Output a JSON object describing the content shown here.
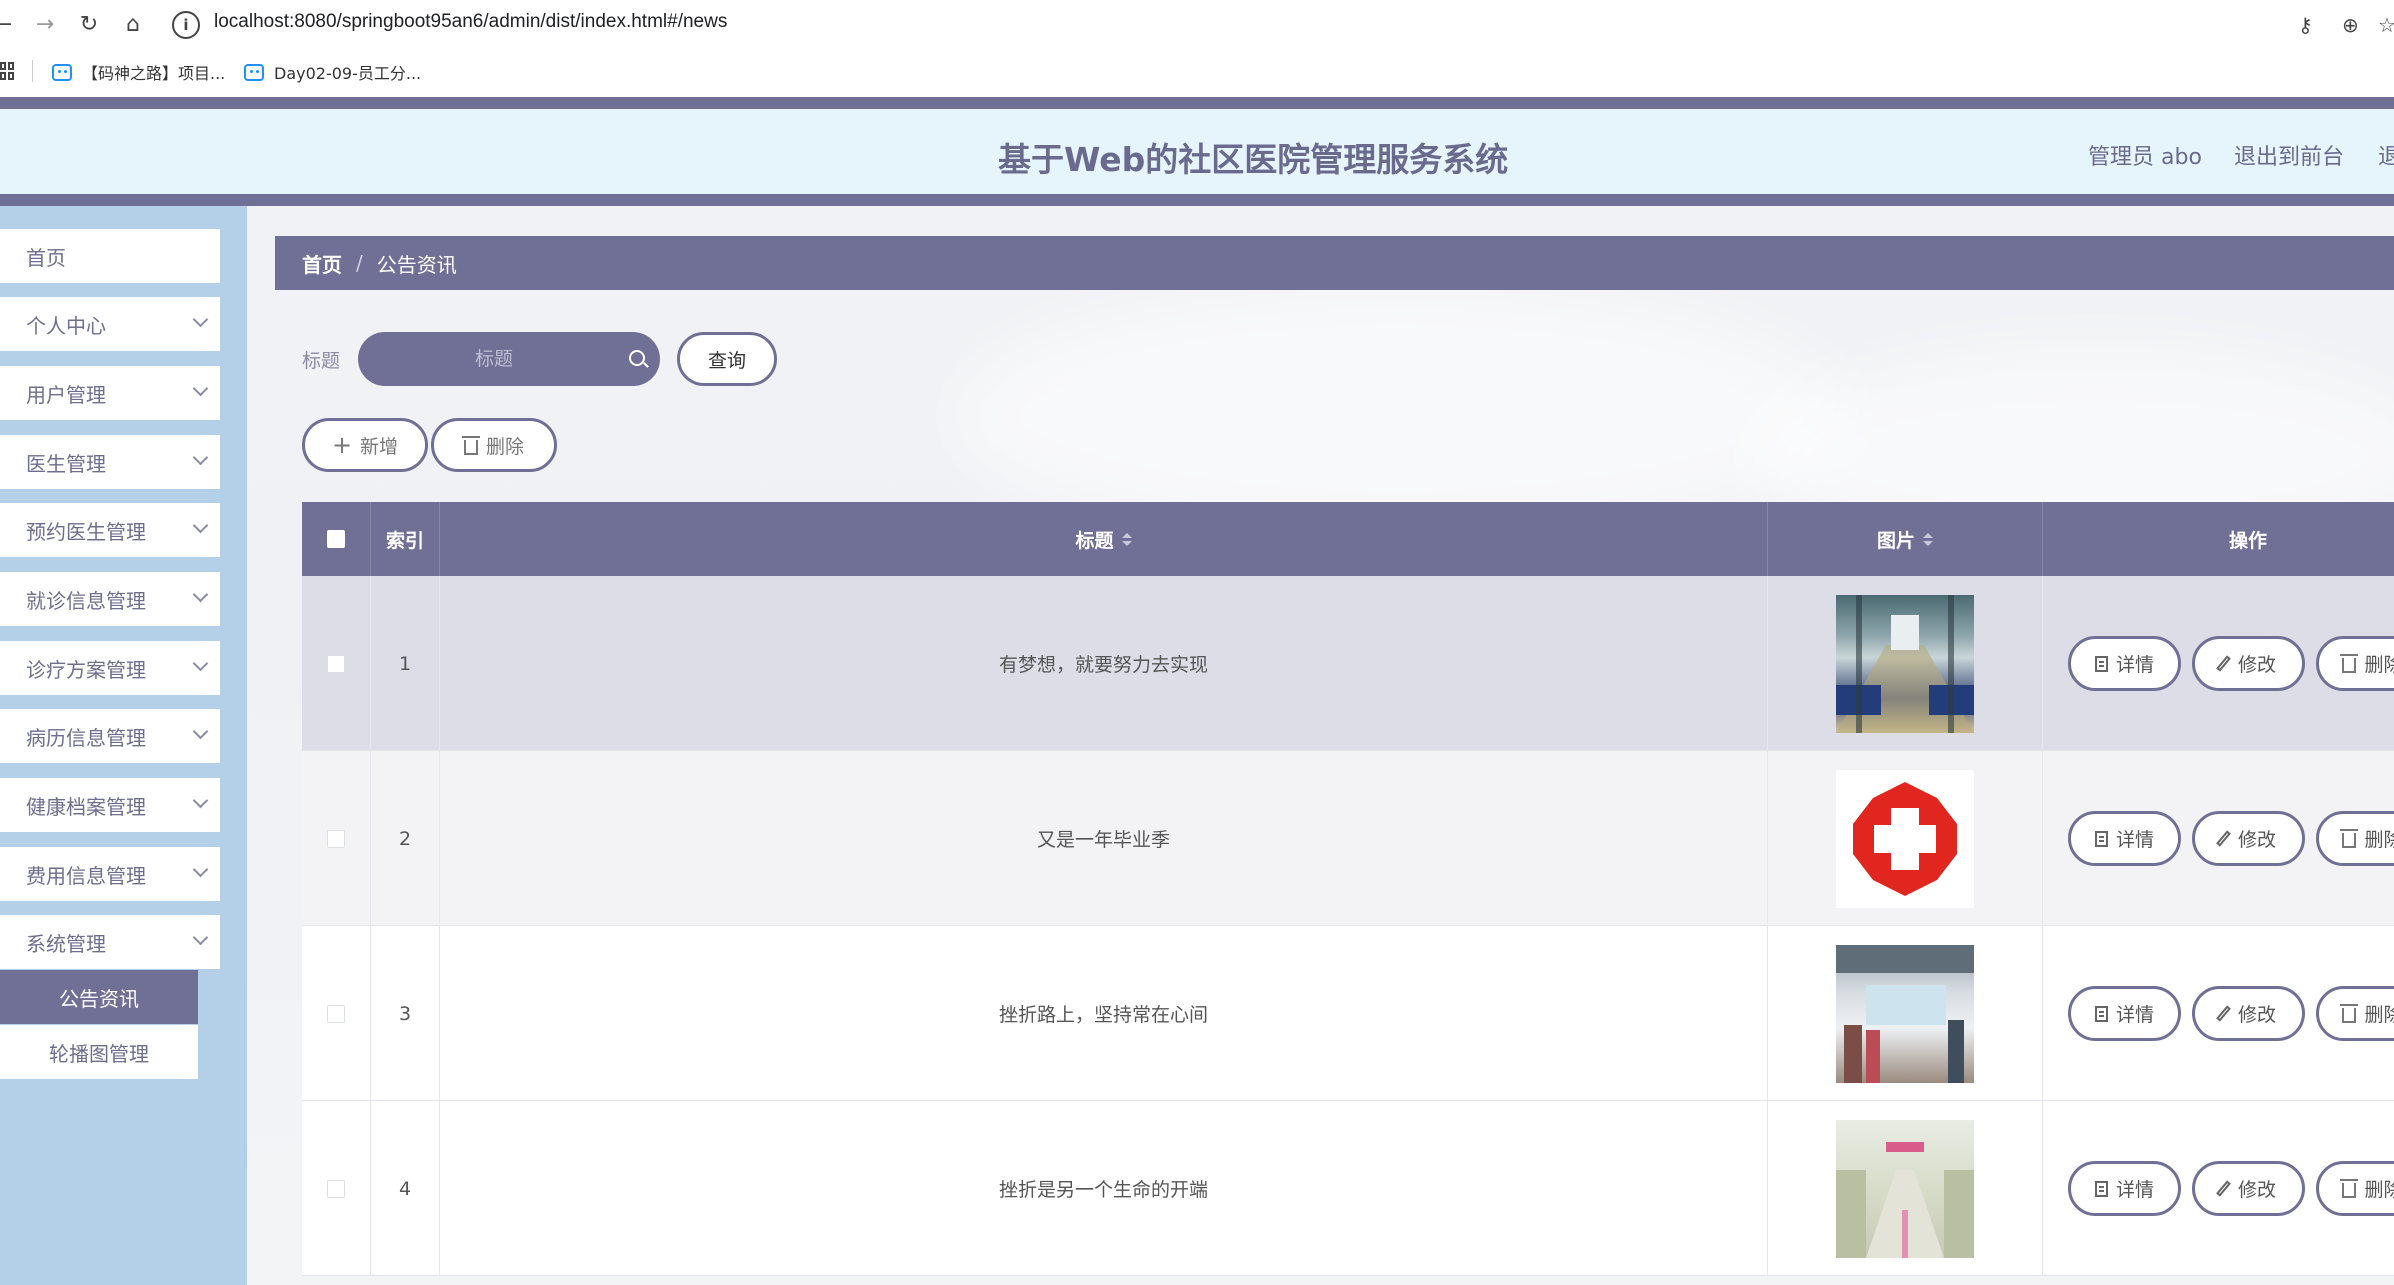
{
  "browser": {
    "url": "localhost:8080/springboot95an6/admin/dist/index.html#/news",
    "bookmarks": [
      "【码神之路】项目...",
      "Day02-09-员工分..."
    ]
  },
  "header": {
    "title": "基于Web的社区医院管理服务系统",
    "admin_label": "管理员 abo",
    "front_link": "退出到前台",
    "logout_link": "退"
  },
  "sidebar": {
    "items": [
      {
        "label": "首页",
        "has_arrow": false
      },
      {
        "label": "个人中心",
        "has_arrow": true
      },
      {
        "label": "用户管理",
        "has_arrow": true
      },
      {
        "label": "医生管理",
        "has_arrow": true
      },
      {
        "label": "预约医生管理",
        "has_arrow": true
      },
      {
        "label": "就诊信息管理",
        "has_arrow": true
      },
      {
        "label": "诊疗方案管理",
        "has_arrow": true
      },
      {
        "label": "病历信息管理",
        "has_arrow": true
      },
      {
        "label": "健康档案管理",
        "has_arrow": true
      },
      {
        "label": "费用信息管理",
        "has_arrow": true
      },
      {
        "label": "系统管理",
        "has_arrow": true
      }
    ],
    "submenu": [
      {
        "label": "公告资讯",
        "active": true
      },
      {
        "label": "轮播图管理",
        "active": false
      }
    ]
  },
  "breadcrumb": {
    "home": "首页",
    "separator": "/",
    "current": "公告资讯"
  },
  "search": {
    "label": "标题",
    "placeholder": "标题",
    "value": "",
    "query_button": "查询"
  },
  "actions": {
    "add": "新增",
    "delete": "删除"
  },
  "table": {
    "columns": {
      "index": "索引",
      "title": "标题",
      "image": "图片",
      "ops": "操作"
    },
    "op_labels": {
      "detail": "详情",
      "edit": "修改",
      "delete": "删除"
    },
    "rows": [
      {
        "index": "1",
        "title": "有梦想，就要努力去实现",
        "image": "hospital-corridor-photo"
      },
      {
        "index": "2",
        "title": "又是一年毕业季",
        "image": "red-cross-logo"
      },
      {
        "index": "3",
        "title": "挫折路上，坚持常在心间",
        "image": "hospital-lobby-photo"
      },
      {
        "index": "4",
        "title": "挫折是另一个生命的开端",
        "image": "hospital-hallway-photo"
      }
    ]
  },
  "colors": {
    "primary": "#706f95",
    "header_bg": "#e6f4fc",
    "sidebar_bg": "#b4cfe8",
    "red_cross": "#e0261e"
  }
}
